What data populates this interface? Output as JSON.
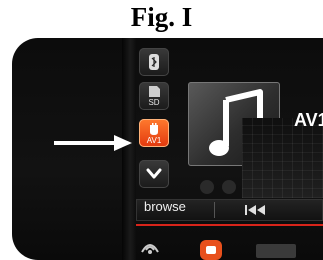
{
  "figure": {
    "title": "Fig. I"
  },
  "sidebar": {
    "items": [
      {
        "name": "bluetooth",
        "label": ""
      },
      {
        "name": "sd",
        "label": "SD"
      },
      {
        "name": "av1",
        "label": "AV1"
      },
      {
        "name": "expand",
        "label": ""
      }
    ]
  },
  "main": {
    "source_label": "AV1",
    "browse_label": "browse"
  },
  "colors": {
    "active": "#f05a1e",
    "accent_red": "#d8241a"
  }
}
